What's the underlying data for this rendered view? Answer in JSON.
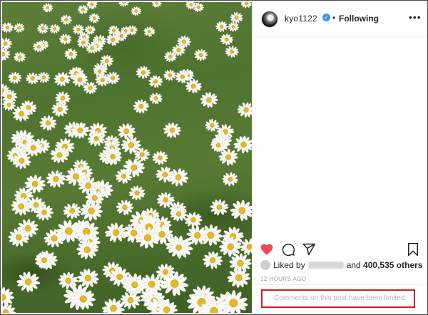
{
  "post": {
    "photo_alt": "",
    "username": "kyo1122",
    "verified_icon": "verified-badge-icon",
    "separator": "•",
    "follow_label": "Following",
    "more_label": "•••",
    "likes_prefix": "Liked by",
    "likes_conjunction": "and",
    "likes_count": "400,535 others",
    "timestamp": "12 HOURS AGO",
    "comments_limited_text": "Comments on this post have been limited."
  },
  "icons": {
    "heart": "heart-icon",
    "comment": "comment-icon",
    "share": "share-icon",
    "save": "bookmark-icon",
    "more": "more-options-icon"
  },
  "colors": {
    "like": "#ed4956",
    "verified": "#3897f0",
    "highlight_border": "#d41c1c",
    "muted_text": "#b5b5b5"
  }
}
